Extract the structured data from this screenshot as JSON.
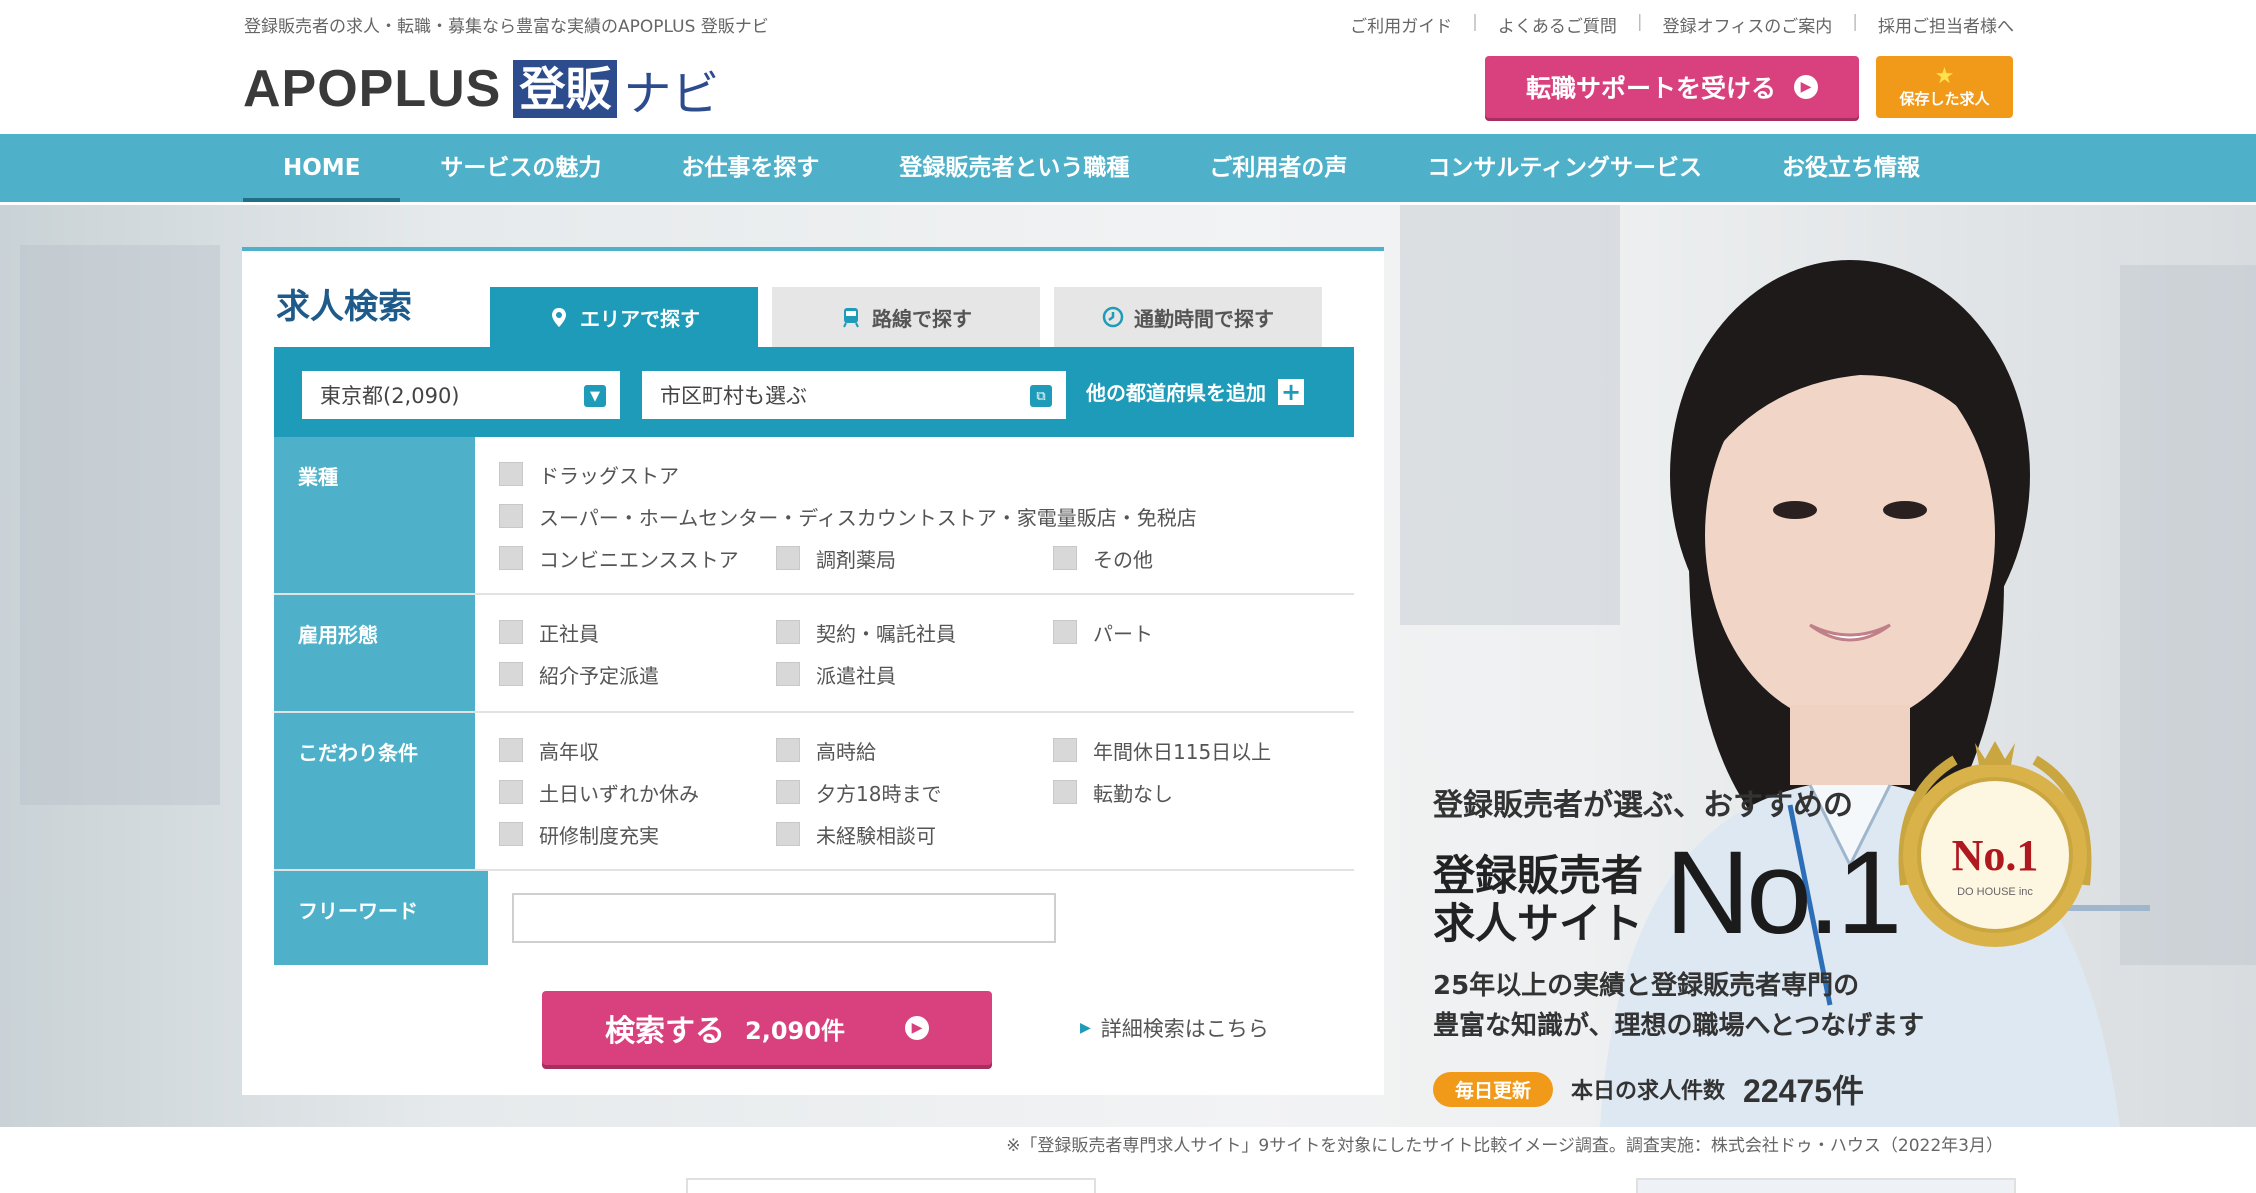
{
  "header": {
    "tagline": "登録販売者の求人・転職・募集なら豊富な実績のAPOPLUS 登販ナビ",
    "util_nav": [
      "ご利用ガイド",
      "よくあるご質問",
      "登録オフィスのご案内",
      "採用ご担当者様へ"
    ],
    "logo": {
      "brand": "APOPLUS",
      "box": "登販",
      "suffix": "ナビ"
    },
    "support_button": "転職サポートを受ける",
    "saved_button": "保存した求人"
  },
  "nav": [
    "HOME",
    "サービスの魅力",
    "お仕事を探す",
    "登録販売者という職種",
    "ご利用者の声",
    "コンサルティングサービス",
    "お役立ち情報"
  ],
  "search": {
    "title": "求人検索",
    "tabs": [
      "エリアで探す",
      "路線で探す",
      "通勤時間で探す"
    ],
    "prefecture": "東京都(2,090)",
    "city_placeholder": "市区町村も選ぶ",
    "add_prefecture": "他の都道府県を追加",
    "filters": {
      "industry": {
        "label": "業種",
        "line1": [
          "ドラッグストア"
        ],
        "line2": [
          "スーパー・ホームセンター・ディスカウントストア・家電量販店・免税店"
        ],
        "line3": [
          "コンビニエンスストア",
          "調剤薬局",
          "その他"
        ]
      },
      "employment": {
        "label": "雇用形態",
        "line1": [
          "正社員",
          "契約・嘱託社員",
          "パート"
        ],
        "line2": [
          "紹介予定派遣",
          "派遣社員"
        ]
      },
      "conditions": {
        "label": "こだわり条件",
        "line1": [
          "高年収",
          "高時給",
          "年間休日115日以上"
        ],
        "line2": [
          "土日いずれか休み",
          "夕方18時まで",
          "転勤なし"
        ],
        "line3": [
          "研修制度充実",
          "未経験相談可"
        ]
      },
      "freeword": {
        "label": "フリーワード",
        "value": ""
      }
    },
    "search_button": {
      "label": "検索する",
      "count": "2,090件"
    },
    "advanced_link": "詳細検索はこちら"
  },
  "hero": {
    "line1": "登録販売者が選ぶ、おすすめの",
    "title_line1": "登録販売者",
    "title_line2": "求人サイト",
    "no1": "No.1",
    "desc_line1": "25年以上の実績と登録販売者専門の",
    "desc_line2": "豊富な知識が、理想の職場へとつなげます",
    "daily_badge": "毎日更新",
    "count_label": "本日の求人件数",
    "count_value": "22475件",
    "medal_text": "No.1",
    "medal_sub": "DO HOUSE inc"
  },
  "footnote": "※「登録販売者専門求人サイト」9サイトを対象にしたサイト比較イメージ調査。調査実施：株式会社ドゥ・ハウス（2022年3月）",
  "colors": {
    "teal": "#4fb1c9",
    "teal_dark": "#1e9bb8",
    "pink": "#d9407e",
    "orange": "#f19a1a",
    "navy": "#2d4c8e"
  }
}
